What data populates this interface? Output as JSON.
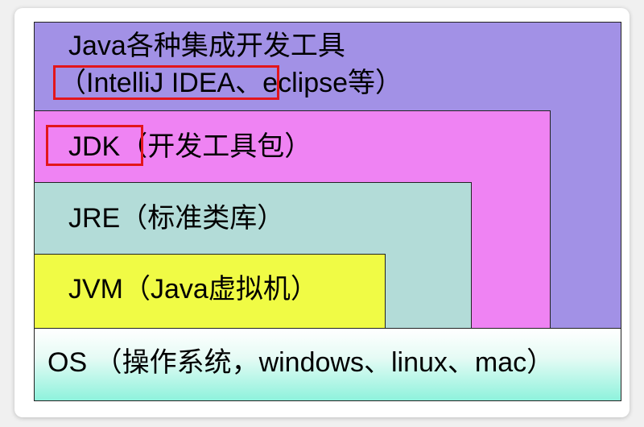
{
  "layers": {
    "tools": {
      "line1": "Java各种集成开发工具",
      "line2": "（IntelliJ IDEA、eclipse等）"
    },
    "jdk": {
      "label": "JDK（开发工具包）"
    },
    "jre": {
      "label": "JRE（标准类库）"
    },
    "jvm": {
      "label": "JVM（Java虚拟机）"
    },
    "os": {
      "label": "OS （操作系统，windows、linux、mac）"
    }
  },
  "colors": {
    "tools": "#a291e6",
    "jdk": "#ef83f3",
    "jre": "#b3dcd8",
    "jvm": "#f0fb45",
    "os": "#8ef2dc",
    "highlight": "#e3161b"
  }
}
